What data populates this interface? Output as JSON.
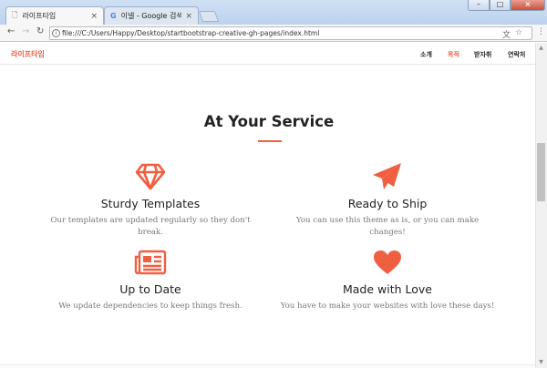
{
  "browser": {
    "tabs": [
      {
        "title": "라이프타임",
        "close": "×"
      },
      {
        "title": "이넬 - Google 검색",
        "close": "×"
      }
    ],
    "window_controls": {
      "minimize": "–",
      "maximize": "□",
      "close": "×"
    },
    "url": "file:///C:/Users/Happy/Desktop/startbootstrap-creative-gh-pages/index.html",
    "nav": {
      "back": "←",
      "forward": "→",
      "reload": "↻",
      "info": "i"
    },
    "omnibox_icons": {
      "translate": "文",
      "bookmark": "☆",
      "menu": "⋮"
    }
  },
  "page_nav": {
    "brand": "라이프타임",
    "links": [
      {
        "label": "소개"
      },
      {
        "label": "목적"
      },
      {
        "label": "받자취"
      },
      {
        "label": "연락처"
      }
    ]
  },
  "section": {
    "title": "At Your Service"
  },
  "services": [
    {
      "icon": "diamond-icon",
      "title": "Sturdy Templates",
      "text": "Our templates are updated regularly so they don't break."
    },
    {
      "icon": "paper-plane-icon",
      "title": "Ready to Ship",
      "text": "You can use this theme as is, or you can make changes!"
    },
    {
      "icon": "newspaper-icon",
      "title": "Up to Date",
      "text": "We update dependencies to keep things fresh."
    },
    {
      "icon": "heart-icon",
      "title": "Made with Love",
      "text": "You have to make your websites with love these days!"
    }
  ],
  "colors": {
    "accent": "#f05f40",
    "text": "#222222",
    "muted": "#777777"
  }
}
